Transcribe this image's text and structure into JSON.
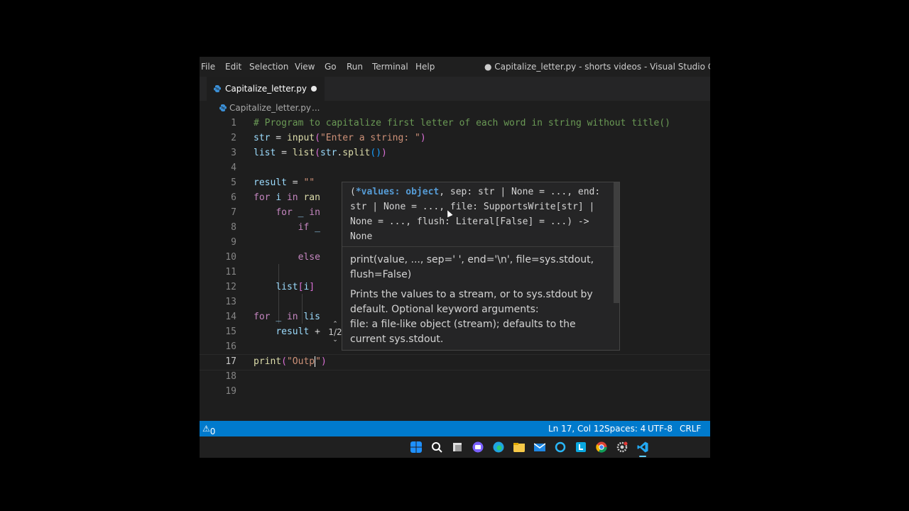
{
  "menu": {
    "items": [
      "File",
      "Edit",
      "Selection",
      "View",
      "Go",
      "Run",
      "Terminal",
      "Help"
    ],
    "window_title": "● Capitalize_letter.py - shorts videos - Visual Studio Code"
  },
  "tab": {
    "label": "Capitalize_letter.py",
    "icon": "python-icon"
  },
  "breadcrumb": {
    "file": "Capitalize_letter.py",
    "ellipsis": "..."
  },
  "editor": {
    "line_numbers": [
      "1",
      "2",
      "3",
      "4",
      "5",
      "6",
      "7",
      "8",
      "9",
      "10",
      "11",
      "12",
      "13",
      "14",
      "15",
      "16",
      "17",
      "18",
      "19"
    ],
    "current_line": 17
  },
  "hover": {
    "signature_start": "(",
    "signature_param": "*values: object",
    "signature_rest": ", sep: str | None = ..., end: str | None = ..., file: SupportsWrite[str] | None = ..., flush: Literal[False] = ...) -> None",
    "doc_sig": "print(value, ..., sep=' ', end='\\n', file=sys.stdout, flush=False)",
    "doc_desc": "Prints the values to a stream, or to sys.stdout by default. Optional keyword arguments:",
    "doc_file": "file: a file-like object (stream); defaults to the current sys.stdout.",
    "pager": "1/2"
  },
  "statusbar": {
    "problems": "0",
    "position": "Ln 17, Col 12",
    "spaces": "Spaces: 4",
    "encoding": "UTF-8",
    "eol": "CRLF"
  },
  "colors": {
    "statusbar": "#007acc",
    "editor_bg": "#1e1e1e",
    "taskbar": "#202020"
  }
}
